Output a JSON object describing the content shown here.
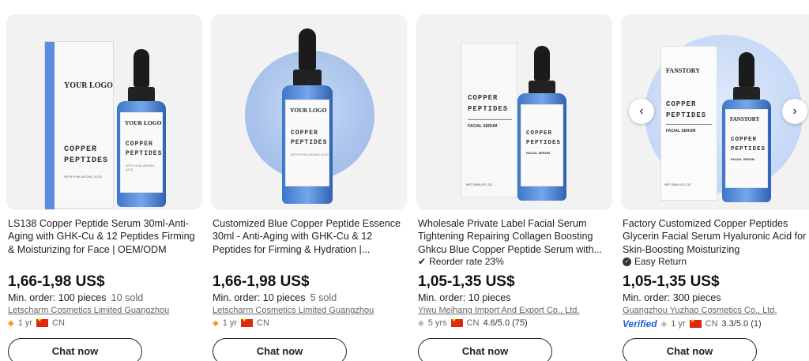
{
  "products": [
    {
      "title": "LS138 Copper Peptide Serum 30ml-Anti-Aging with GHK-Cu & 12 Peptides Firming & Moisturizing for Face | OEM/ODM",
      "perk": "",
      "price": "1,66-1,98 US$",
      "moq": "Min. order: 100 pieces",
      "sold": "10 sold",
      "supplier": "Letscharm Cosmetics Limited Guangzhou",
      "years": "1 yr",
      "country": "CN",
      "rating": "",
      "image": {
        "logo": "YOUR LOGO",
        "name_line1": "COPPER",
        "name_line2": "PEPTIDES",
        "sub": "WITH HYALURONIC ACID",
        "bottle_logo": "YOUR LOGO"
      }
    },
    {
      "title": "Customized Blue Copper Peptide Essence 30ml - Anti-Aging with GHK-Cu & 12 Peptides for Firming & Hydration |...",
      "perk": "",
      "price": "1,66-1,98 US$",
      "moq": "Min. order: 10 pieces",
      "sold": "5 sold",
      "supplier": "Letscharm Cosmetics Limited Guangzhou",
      "years": "1 yr",
      "country": "CN",
      "rating": "",
      "image": {
        "bottle_logo": "YOUR LOGO",
        "name_line1": "COPPER",
        "name_line2": "PEPTIDES",
        "sub": "WITH HYALURONIC ACID"
      }
    },
    {
      "title": "Wholesale Private Label Facial Serum Tightening Repairing Collagen Boosting Ghkcu Blue Copper Peptide Serum with...",
      "perk": "Reorder rate 23%",
      "price": "1,05-1,35 US$",
      "moq": "Min. order: 10 pieces",
      "sold": "",
      "supplier": "Yiwu Meihang Import And Export Co., Ltd.",
      "years": "5 yrs",
      "country": "CN",
      "rating": "4.6/5.0 (75)",
      "image": {
        "name_line1": "COPPER",
        "name_line2": "PEPTIDES",
        "sub": "FACIAL SERUM",
        "net": "NET:30ML/1FL.OZ"
      }
    },
    {
      "title": "Factory Customized Copper Peptides Glycerin Facial Serum Hyaluronic Acid for Skin-Boosting Moisturizing",
      "perk": "Easy Return",
      "price": "1,05-1,35 US$",
      "moq": "Min. order: 300 pieces",
      "sold": "",
      "supplier": "Guangzhou Yuzhao Cosmetics Co., Ltd.",
      "verified": "Verified",
      "years": "1 yr",
      "country": "CN",
      "rating": "3.3/5.0 (1)",
      "image": {
        "brand": "FANSTORY",
        "name_line1": "COPPER",
        "name_line2": "PEPTIDES",
        "sub": "FACIAL SERUM",
        "net": "NET:30ML/1FL.OZ"
      }
    }
  ],
  "chat_label": "Chat now",
  "colors": {
    "accent_blue": "#1e5bd6",
    "medal": "#f59b23",
    "flag": "#de2910"
  },
  "icons": {
    "prev": "chevron-left-icon",
    "next": "chevron-right-icon",
    "perk_reorder": "check-icon",
    "perk_return": "shield-check-icon"
  }
}
